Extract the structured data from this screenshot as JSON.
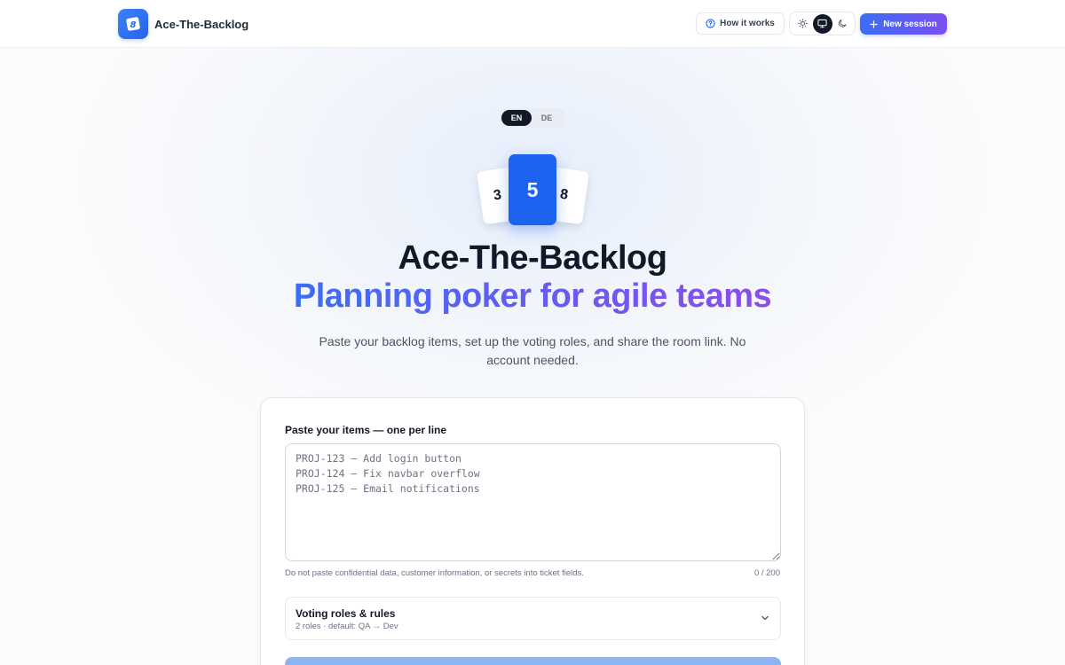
{
  "header": {
    "brand_name": "Ace-The-Backlog",
    "logo_glyph": "8",
    "how_it_works": "How it works",
    "new_session": "New session",
    "theme_options": [
      "light",
      "system",
      "dark"
    ],
    "theme_selected": "system"
  },
  "language": {
    "options": [
      "EN",
      "DE"
    ],
    "selected": "EN"
  },
  "hero_cards": {
    "left": "3",
    "center": "5",
    "right": "8"
  },
  "hero": {
    "title": "Ace-The-Backlog",
    "subtitle": "Planning poker for agile teams",
    "description": "Paste your backlog items, set up the voting roles, and share the room link. No account needed."
  },
  "form": {
    "items_label": "Paste your items — one per line",
    "items_placeholder": "PROJ-123 — Add login button\nPROJ-124 — Fix navbar overflow\nPROJ-125 — Email notifications",
    "hint": "Do not paste confidential data, customer information, or secrets into ticket fields.",
    "counter": "0 / 200",
    "roles_title": "Voting roles & rules",
    "roles_summary": "2 roles · default: QA → Dev"
  },
  "colors": {
    "accent": "#1d63f0",
    "gradient_start": "#3b6ef5",
    "gradient_end": "#8b4dea",
    "submit_disabled": "#8bb4f5"
  }
}
